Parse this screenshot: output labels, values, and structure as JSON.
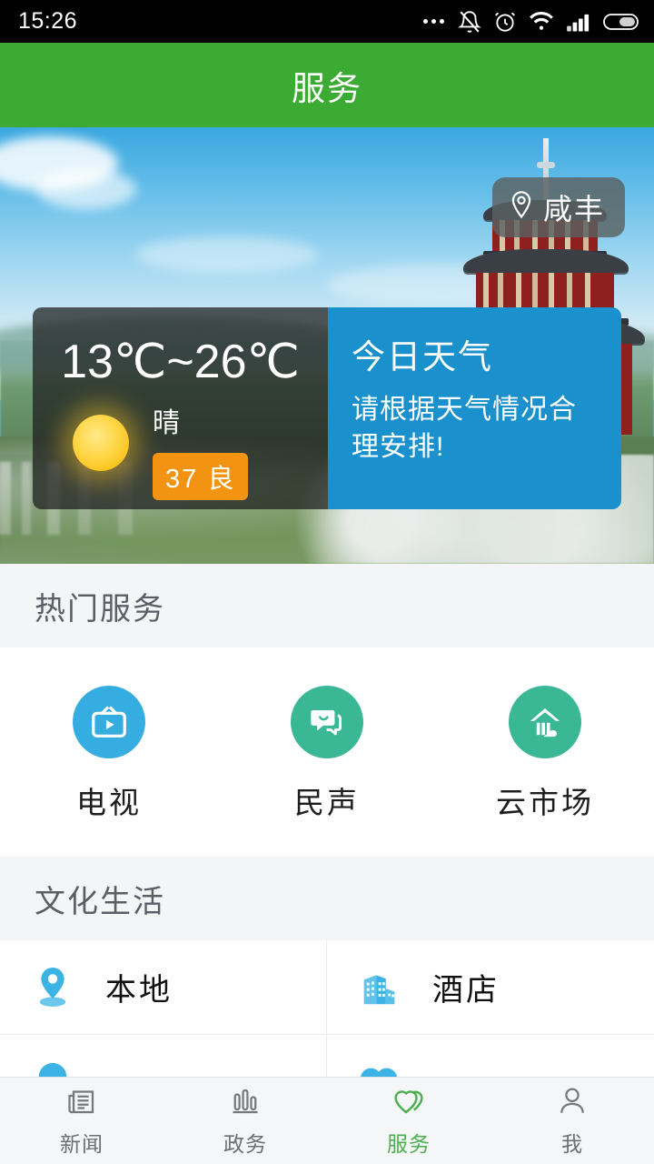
{
  "statusbar": {
    "time": "15:26",
    "icons": [
      "more-dots-icon",
      "notification-muted-icon",
      "alarm-clock-icon",
      "wifi-icon",
      "signal-bars-icon",
      "battery-icon"
    ]
  },
  "titlebar": {
    "title": "服务",
    "background_color": "#3cab33"
  },
  "hero": {
    "location_badge": {
      "icon": "location-pin-icon",
      "label": "咸丰"
    },
    "weather": {
      "temperature_range": "13℃~26℃",
      "condition": "晴",
      "condition_icon": "sun-icon",
      "aqi_value": "37",
      "aqi_level": "良",
      "aqi_color": "#f29312",
      "panel_title": "今日天气",
      "panel_desc": "请根据天气情况合理安排!",
      "panel_color": "#1a91cd"
    }
  },
  "hot_services": {
    "header": "热门服务",
    "items": [
      {
        "label": "电视",
        "icon": "tv-icon",
        "color": "#35ade0"
      },
      {
        "label": "民声",
        "icon": "chat-bubbles-icon",
        "color": "#3ab795"
      },
      {
        "label": "云市场",
        "icon": "market-house-icon",
        "color": "#3ab795"
      }
    ]
  },
  "cultural_life": {
    "header": "文化生活",
    "items": [
      {
        "label": "本地",
        "icon": "location-pin-icon",
        "color": "#3bb4e5"
      },
      {
        "label": "酒店",
        "icon": "hotel-buildings-icon",
        "color": "#3bb4e5"
      }
    ]
  },
  "bottom_nav": {
    "active_color": "#4caf50",
    "items": [
      {
        "label": "新闻",
        "icon": "newspaper-icon",
        "active": false
      },
      {
        "label": "政务",
        "icon": "bar-chart-icon",
        "active": false
      },
      {
        "label": "服务",
        "icon": "heart-icon",
        "active": true
      },
      {
        "label": "我",
        "icon": "person-icon",
        "active": false
      }
    ]
  }
}
